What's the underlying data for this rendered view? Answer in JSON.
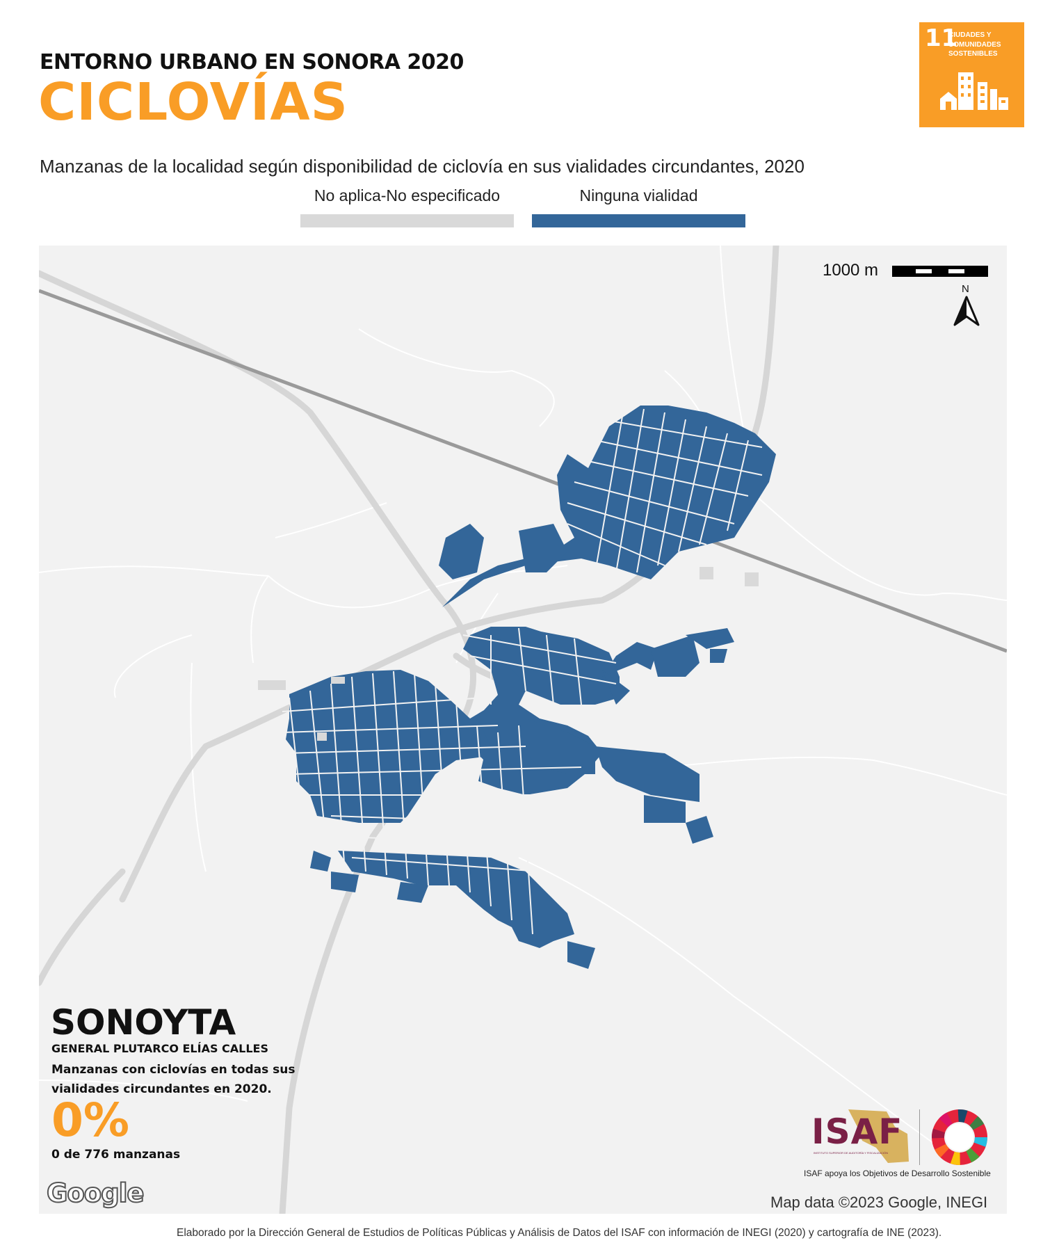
{
  "header": {
    "kicker": "ENTORNO URBANO EN SONORA 2020",
    "title": "CICLOVÍAS",
    "subtitle": "Manzanas de la localidad según disponibilidad de ciclovía en sus vialidades circundantes, 2020"
  },
  "sdg_badge": {
    "number": "11",
    "lines": [
      "CIUDADES Y",
      "COMUNIDADES",
      "SOSTENIBLES"
    ],
    "color": "#f99d26"
  },
  "legend": [
    {
      "label": "No aplica-No especificado",
      "color": "#d9d9d9"
    },
    {
      "label": "Ninguna vialidad",
      "color": "#336699"
    }
  ],
  "map": {
    "scale_label": "1000 m",
    "north_label": "N",
    "attribution": "Map data ©2023 Google, INEGI",
    "google_logo": "Google"
  },
  "locality": {
    "name": "SONOYTA",
    "municipality": "GENERAL PLUTARCO ELÍAS CALLES",
    "description": "Manzanas con ciclovías en todas sus vialidades circundantes en 2020.",
    "percent": "0%",
    "count": "0 de 776 manzanas",
    "accent_color": "#f99d26"
  },
  "isaf": {
    "name": "ISAF",
    "fullname": "INSTITUTO SUPERIOR DE AUDITORÍA Y FISCALIZACIÓN",
    "tagline": "ISAF apoya los Objetivos de Desarrollo Sostenible",
    "color": "#7a2046"
  },
  "footer": {
    "credit": "Elaborado por la Dirección General de Estudios de Políticas Públicas y Análisis de Datos del ISAF con información de INEGI (2020) y cartografía de INE (2023)."
  }
}
